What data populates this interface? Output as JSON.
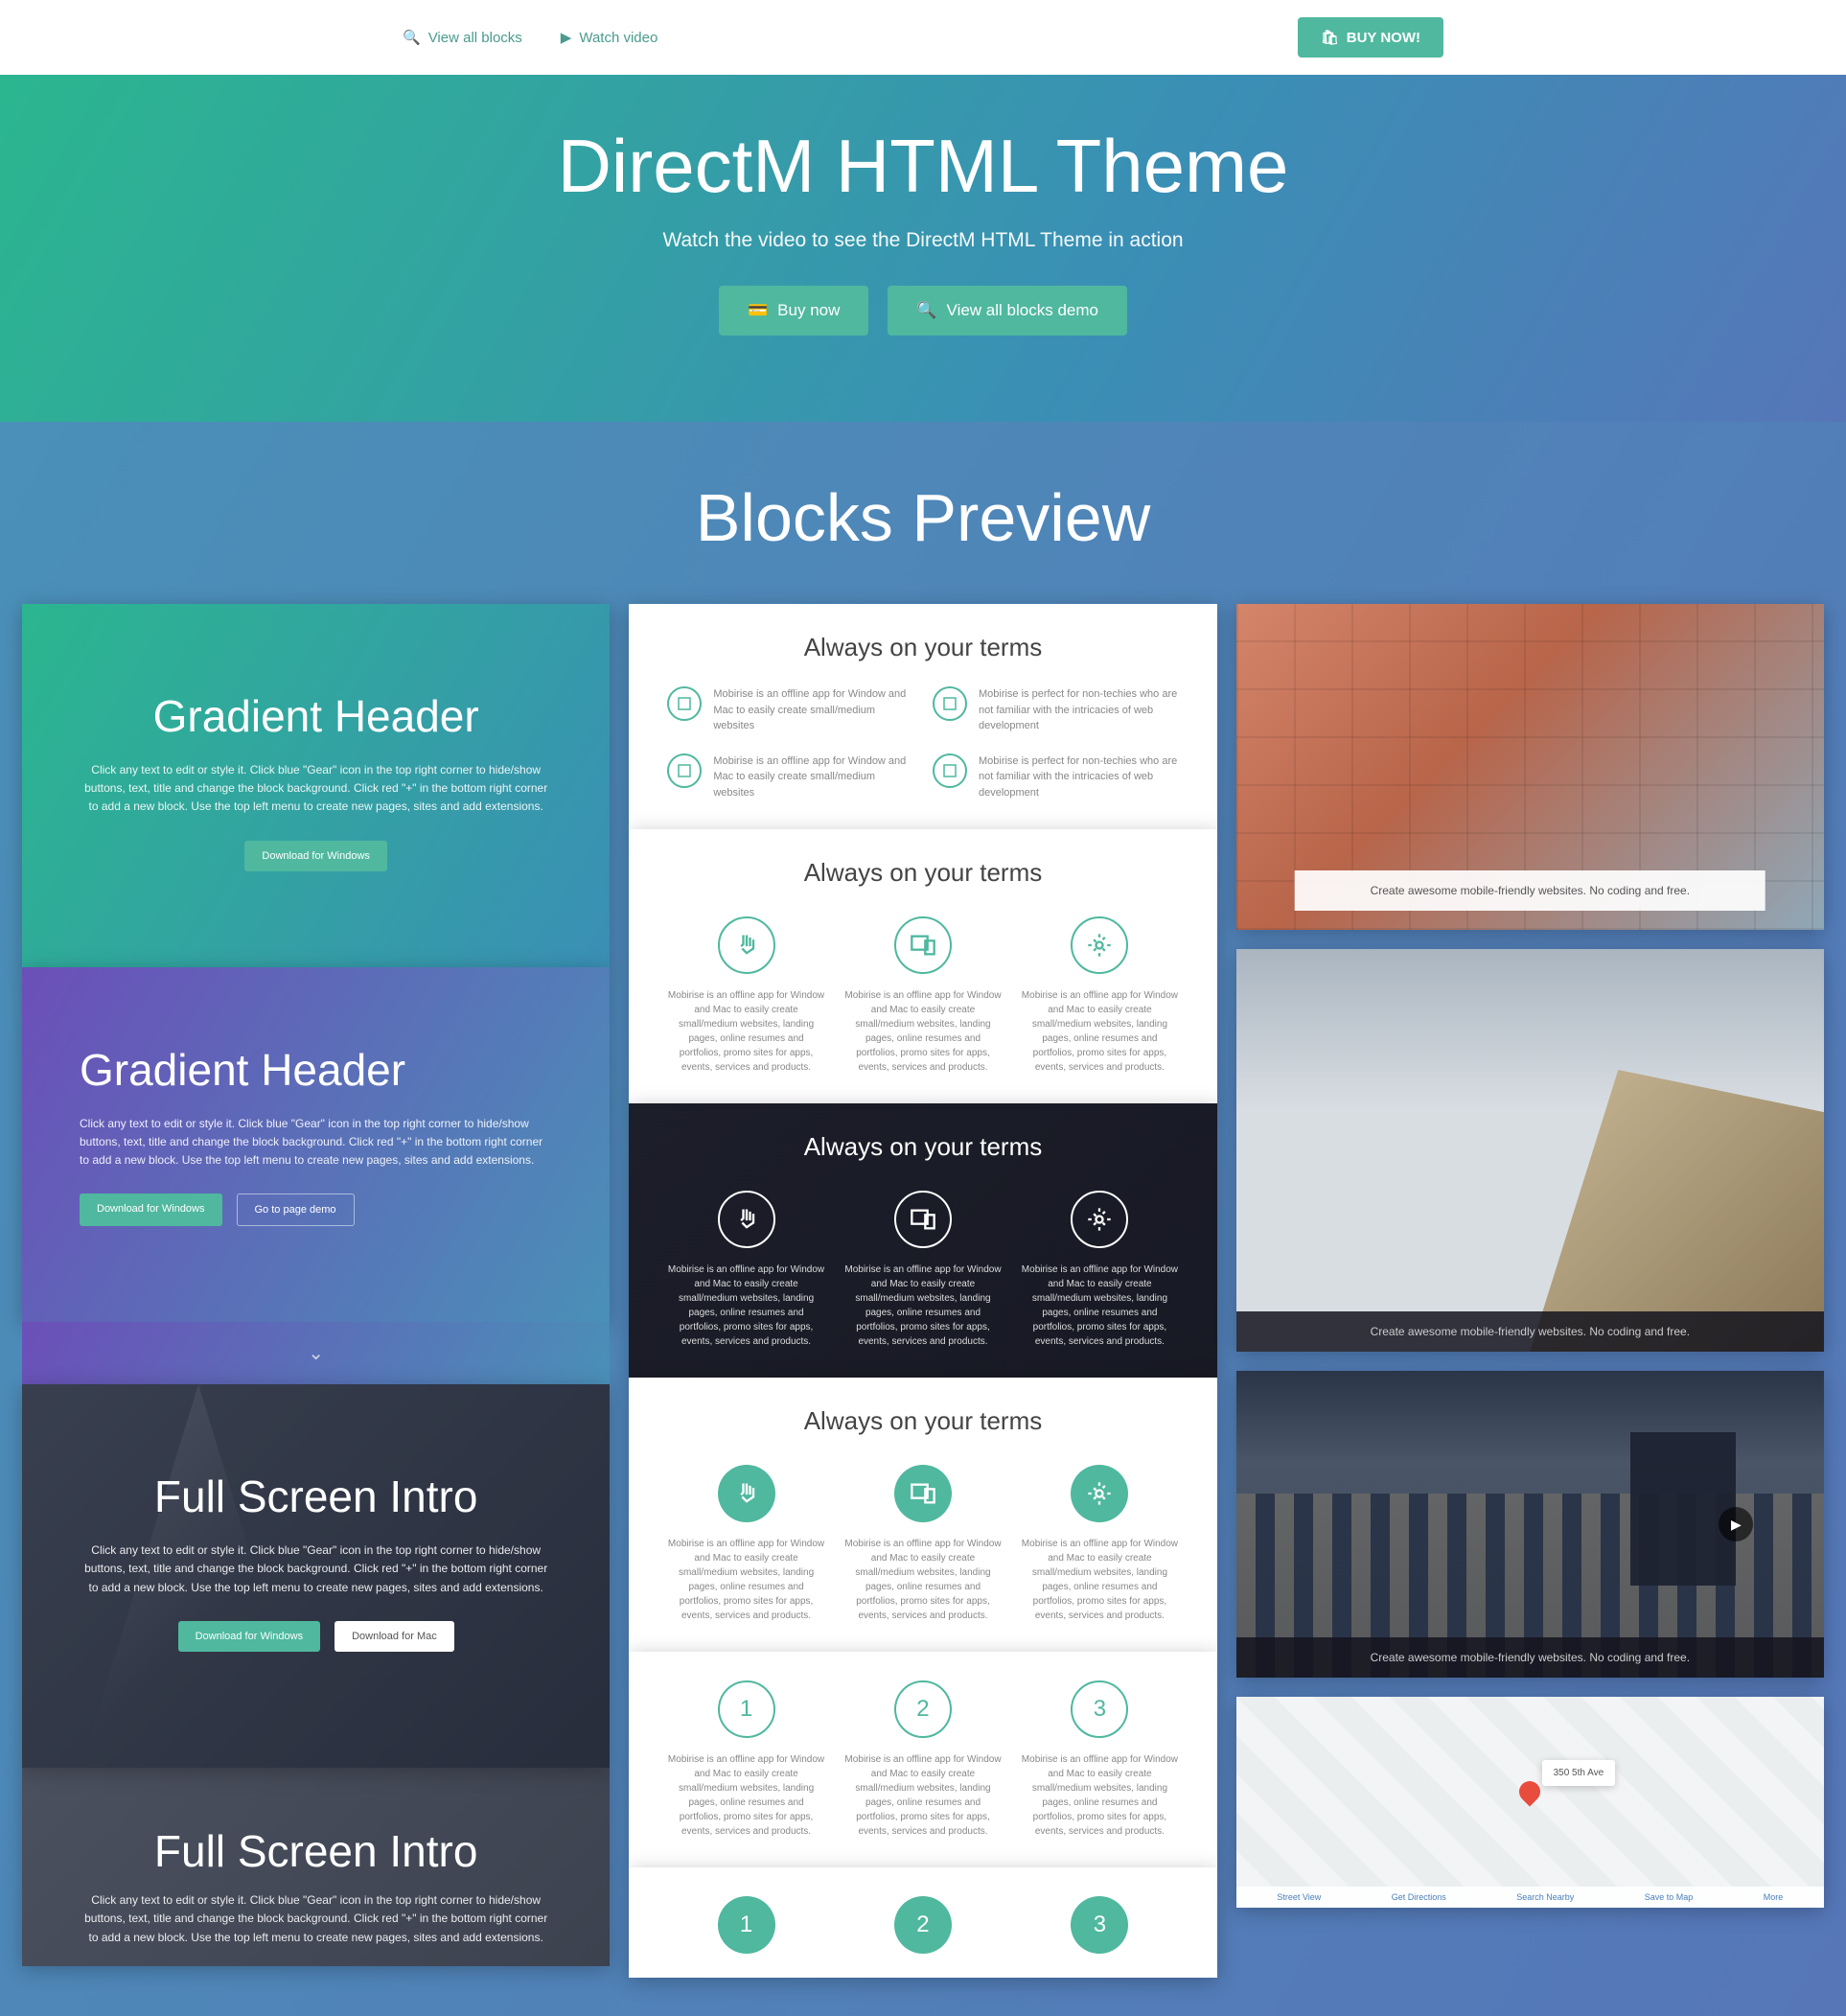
{
  "topbar": {
    "view_all": "View all blocks",
    "watch_video": "Watch video",
    "buy_now": "BUY NOW!"
  },
  "hero": {
    "title": "DirectM HTML Theme",
    "subtitle": "Watch the video to see the DirectM HTML Theme in action",
    "buy_btn": "Buy now",
    "blocks_btn": "View all blocks demo"
  },
  "preview_title": "Blocks Preview",
  "gradient1": {
    "title": "Gradient Header",
    "desc": "Click any text to edit or style it. Click blue \"Gear\" icon in the top right corner to hide/show buttons, text, title and change the block background. Click red \"+\" in the bottom right corner to add a new block. Use the top left menu to create new pages, sites and add extensions.",
    "btn": "Download for Windows"
  },
  "gradient2": {
    "title": "Gradient Header",
    "desc": "Click any text to edit or style it. Click blue \"Gear\" icon in the top right corner to hide/show buttons, text, title and change the block background. Click red \"+\" in the bottom right corner to add a new block. Use the top left menu to create new pages, sites and add extensions.",
    "btn1": "Download for Windows",
    "btn2": "Go to page demo"
  },
  "intro1": {
    "title": "Full Screen Intro",
    "desc": "Click any text to edit or style it. Click blue \"Gear\" icon in the top right corner to hide/show buttons, text, title and change the block background. Click red \"+\" in the bottom right corner to add a new block. Use the top left menu to create new pages, sites and add extensions.",
    "btn1": "Download for Windows",
    "btn2": "Download for Mac"
  },
  "intro2": {
    "title": "Full Screen Intro",
    "desc": "Click any text to edit or style it. Click blue \"Gear\" icon in the top right corner to hide/show buttons, text, title and change the block background. Click red \"+\" in the bottom right corner to add a new block. Use the top left menu to create new pages, sites and add extensions."
  },
  "features": {
    "title": "Always on your terms",
    "item_text_a": "Mobirise is an offline app for Window and Mac to easily create small/medium websites",
    "item_text_b": "Mobirise is perfect for non-techies who are not familiar with the intricacies of web development",
    "long_text": "Mobirise is an offline app for Window and Mac to easily create small/medium websites, landing pages, online resumes and portfolios, promo sites for apps, events, services and products."
  },
  "numbers": [
    "1",
    "2",
    "3"
  ],
  "img_caption1": "Create awesome mobile-friendly websites. No coding and free.",
  "img_caption2": "Create awesome mobile-friendly websites. No coding and free.",
  "img_caption3": "Create awesome mobile-friendly websites. No coding and free.",
  "map": {
    "address": "350 5th Ave",
    "labels": [
      "Street View",
      "Get Directions",
      "Search Nearby",
      "Save to Map",
      "More"
    ]
  }
}
